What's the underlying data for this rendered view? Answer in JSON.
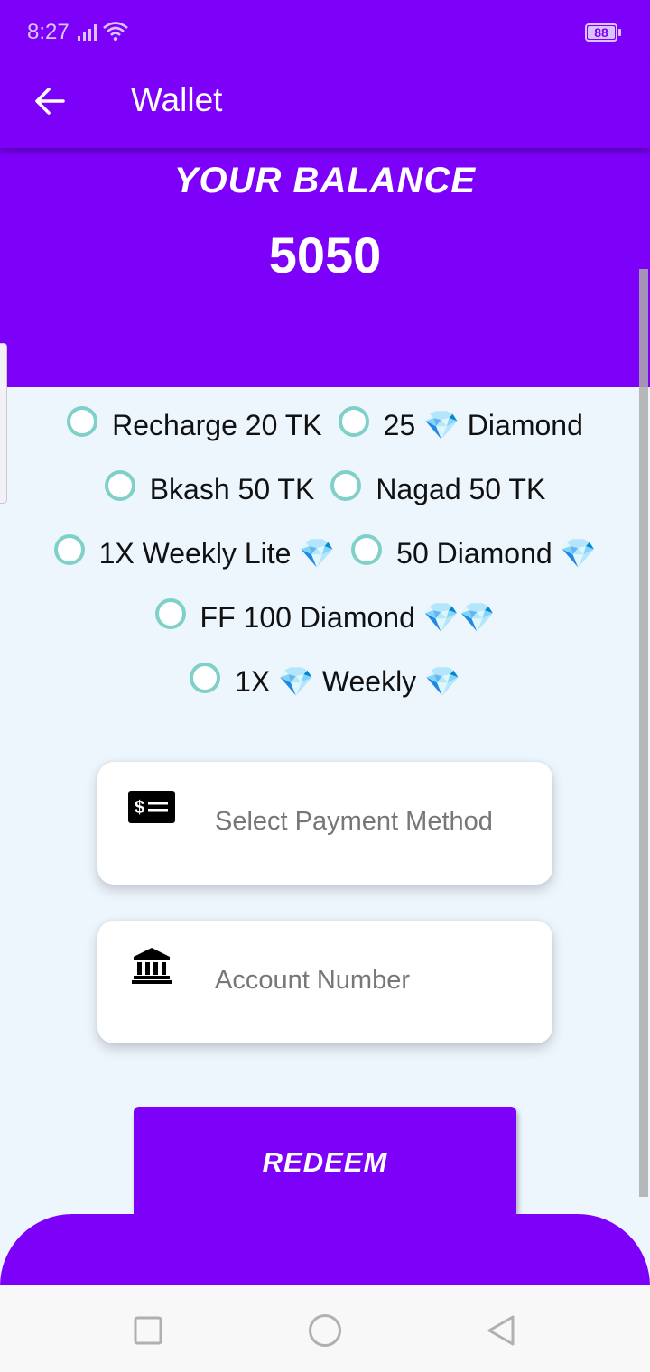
{
  "status_bar": {
    "time": "8:27",
    "battery": "88",
    "icons": [
      "signal-icon",
      "wifi-icon",
      "battery-icon"
    ]
  },
  "app_bar": {
    "title": "Wallet",
    "back_icon": "arrow-left-icon"
  },
  "balance": {
    "label": "YOUR BALANCE",
    "value": "5050"
  },
  "options": [
    {
      "label": "Recharge 20 TK"
    },
    {
      "label": "25 💎 Diamond"
    },
    {
      "label": "Bkash 50 TK"
    },
    {
      "label": "Nagad 50 TK"
    },
    {
      "label": "1X Weekly Lite 💎"
    },
    {
      "label": "50 Diamond 💎"
    },
    {
      "label": "FF 100 Diamond 💎💎"
    },
    {
      "label": "1X 💎 Weekly 💎"
    }
  ],
  "payment_method": {
    "placeholder": "Select Payment Method",
    "icon": "money-bill-icon"
  },
  "account_number": {
    "placeholder": "Account Number",
    "icon": "bank-icon"
  },
  "redeem": {
    "label": "REDEEM"
  },
  "colors": {
    "primary": "#7d00f9",
    "background": "#edf5fd",
    "radio": "#7fd0c8"
  },
  "nav_bar": {
    "icons": [
      "recent-apps-icon",
      "home-icon",
      "back-icon"
    ]
  }
}
